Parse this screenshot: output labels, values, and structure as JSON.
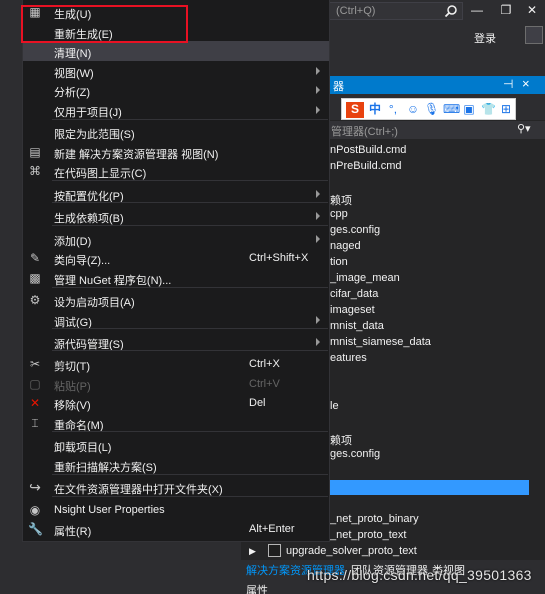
{
  "ide": {
    "quick_launch_placeholder": "(Ctrl+Q)",
    "login": "登录",
    "solution_explorer_title": "器",
    "solution_search_placeholder": "管理器(Ctrl+;)",
    "tree_items": [
      "nPostBuild.cmd",
      "nPreBuild.cmd",
      "赖项",
      "cpp",
      "ges.config",
      "naged",
      "tion",
      "_image_mean",
      "cifar_data",
      "imageset",
      "mnist_data",
      "mnist_siamese_data",
      "eatures",
      "le",
      "赖项",
      "ges.config",
      "_net_proto_binary",
      "_net_proto_text",
      "upgrade_solver_proto_text"
    ],
    "bottom_tabs": [
      "解决方案资源管理器",
      "团队资源管理器",
      "类视图"
    ],
    "properties_label": "属性",
    "ime": {
      "brand": "S",
      "mode": "中"
    },
    "watermark": "https://blog.csdn.net/qq_39501363"
  },
  "menu": {
    "items": [
      {
        "label": "生成(U)",
        "icon": "build-icon",
        "shortcut": "",
        "submenu": false,
        "disabled": false
      },
      {
        "label": "重新生成(E)",
        "icon": "",
        "shortcut": "",
        "submenu": false,
        "disabled": false
      },
      {
        "label": "清理(N)",
        "icon": "",
        "shortcut": "",
        "submenu": false,
        "disabled": false,
        "hover": true
      },
      {
        "label": "视图(W)",
        "icon": "",
        "shortcut": "",
        "submenu": true,
        "disabled": false
      },
      {
        "label": "分析(Z)",
        "icon": "",
        "shortcut": "",
        "submenu": true,
        "disabled": false
      },
      {
        "label": "仅用于项目(J)",
        "icon": "",
        "shortcut": "",
        "submenu": true,
        "disabled": false
      },
      {
        "label": "限定为此范围(S)",
        "icon": "",
        "shortcut": "",
        "submenu": false,
        "disabled": false
      },
      {
        "label": "新建 解决方案资源管理器 视图(N)",
        "icon": "new-view-icon",
        "shortcut": "",
        "submenu": false,
        "disabled": false
      },
      {
        "label": "在代码图上显示(C)",
        "icon": "code-map-icon",
        "shortcut": "",
        "submenu": false,
        "disabled": false
      },
      {
        "label": "按配置优化(P)",
        "icon": "",
        "shortcut": "",
        "submenu": true,
        "disabled": false
      },
      {
        "label": "生成依赖项(B)",
        "icon": "",
        "shortcut": "",
        "submenu": true,
        "disabled": false
      },
      {
        "label": "添加(D)",
        "icon": "",
        "shortcut": "",
        "submenu": true,
        "disabled": false
      },
      {
        "label": "类向导(Z)...",
        "icon": "class-wizard-icon",
        "shortcut": "Ctrl+Shift+X",
        "submenu": false,
        "disabled": false
      },
      {
        "label": "管理 NuGet 程序包(N)...",
        "icon": "nuget-icon",
        "shortcut": "",
        "submenu": false,
        "disabled": false
      },
      {
        "label": "设为启动项目(A)",
        "icon": "gear-icon",
        "shortcut": "",
        "submenu": false,
        "disabled": false
      },
      {
        "label": "调试(G)",
        "icon": "",
        "shortcut": "",
        "submenu": true,
        "disabled": false
      },
      {
        "label": "源代码管理(S)",
        "icon": "",
        "shortcut": "",
        "submenu": true,
        "disabled": false
      },
      {
        "label": "剪切(T)",
        "icon": "scissors-icon",
        "shortcut": "Ctrl+X",
        "submenu": false,
        "disabled": false
      },
      {
        "label": "粘贴(P)",
        "icon": "paste-icon",
        "shortcut": "Ctrl+V",
        "submenu": false,
        "disabled": true
      },
      {
        "label": "移除(V)",
        "icon": "remove-icon",
        "shortcut": "Del",
        "submenu": false,
        "disabled": false
      },
      {
        "label": "重命名(M)",
        "icon": "rename-icon",
        "shortcut": "",
        "submenu": false,
        "disabled": false
      },
      {
        "label": "卸载项目(L)",
        "icon": "",
        "shortcut": "",
        "submenu": false,
        "disabled": false
      },
      {
        "label": "重新扫描解决方案(S)",
        "icon": "",
        "shortcut": "",
        "submenu": false,
        "disabled": false
      },
      {
        "label": "在文件资源管理器中打开文件夹(X)",
        "icon": "open-folder-icon",
        "shortcut": "",
        "submenu": false,
        "disabled": false
      },
      {
        "label": "Nsight User Properties",
        "icon": "nsight-icon",
        "shortcut": "",
        "submenu": false,
        "disabled": false
      },
      {
        "label": "属性(R)",
        "icon": "wrench-icon",
        "shortcut": "Alt+Enter",
        "submenu": false,
        "disabled": false
      }
    ],
    "icon_glyphs": {
      "build-icon": "▦",
      "new-view-icon": "▤",
      "code-map-icon": "⌘",
      "class-wizard-icon": "✎",
      "nuget-icon": "▩",
      "gear-icon": "⚙",
      "scissors-icon": "✂",
      "paste-icon": "▢",
      "remove-icon": "✕",
      "rename-icon": "⌶",
      "open-folder-icon": "↪",
      "nsight-icon": "◉",
      "wrench-icon": "🔧"
    },
    "colors": {
      "remove": "#e51400",
      "accent": "#007acc",
      "highlight_box": "#e81123"
    }
  }
}
